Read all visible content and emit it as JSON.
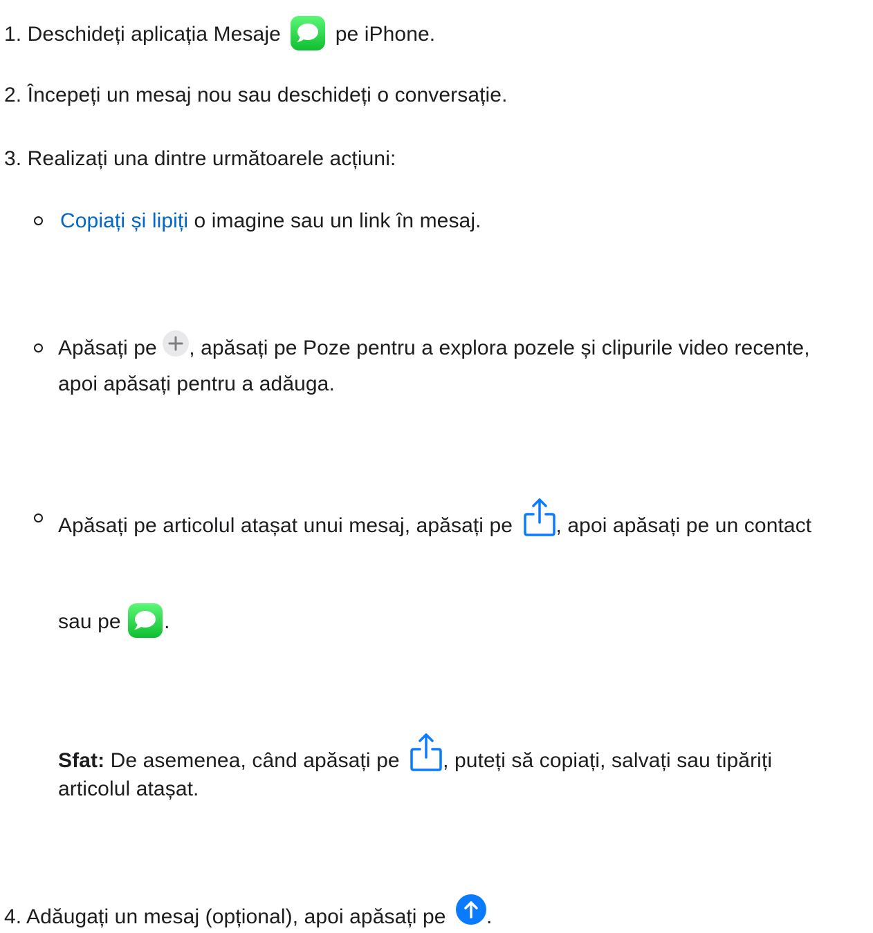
{
  "steps": [
    {
      "number": "1.",
      "before": "Deschideți aplicația Mesaje",
      "after": "pe iPhone."
    },
    {
      "number": "2.",
      "text": "Începeți un mesaj nou sau deschideți o conversație."
    },
    {
      "number": "3.",
      "text": "Realizați una dintre următoarele acțiuni:"
    },
    {
      "number": "4.",
      "before": "Adăugați un mesaj (opțional), apoi apăsați pe",
      "after": "."
    }
  ],
  "actions": {
    "copy": {
      "link": "Copiați și lipiți",
      "rest": "o imagine sau un link în mesaj."
    },
    "photos": {
      "before": "Apăsați pe",
      "after": ", apăsați pe Poze pentru a explora pozele și clipurile video recente,",
      "line2": "apoi apăsați pentru a adăuga."
    },
    "share": {
      "before": "Apăsați pe articolul atașat unui mesaj, apăsați pe",
      "after": ", apoi apăsați pe un contact",
      "line2_before": "sau pe",
      "line2_after": "."
    },
    "tip": {
      "label": "Sfat:",
      "before": "De asemenea, când apăsați pe",
      "after": ", puteți să copiați, salvați sau tipăriți",
      "line2": "articolul atașat."
    }
  },
  "icons": {
    "messages": "messages-app-icon",
    "plus": "plus-icon",
    "share": "share-icon",
    "send": "send-arrow-icon"
  },
  "colors": {
    "link": "#0066cc",
    "messages_green": "#1fd245",
    "send_blue": "#0a7aff",
    "share_blue": "#0a7aff"
  }
}
